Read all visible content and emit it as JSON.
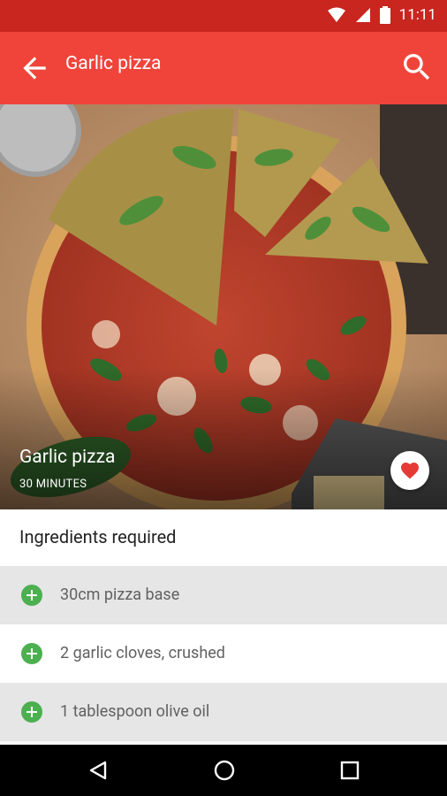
{
  "status": {
    "time": "11:11"
  },
  "appbar": {
    "title": "Garlic pizza",
    "back_icon": "arrow-back-icon",
    "search_icon": "search-icon"
  },
  "hero": {
    "title": "Garlic pizza",
    "subtitle": "30 MINUTES",
    "favorite_icon": "heart-icon"
  },
  "ingredients": {
    "title": "Ingredients required",
    "items": [
      {
        "label": "30cm pizza base"
      },
      {
        "label": "2 garlic cloves, crushed"
      },
      {
        "label": "1 tablespoon olive oil"
      }
    ]
  },
  "colors": {
    "primary": "#f0443b",
    "primary_dark": "#c8261f",
    "accent_green": "#4caf50",
    "heart": "#e53935"
  }
}
